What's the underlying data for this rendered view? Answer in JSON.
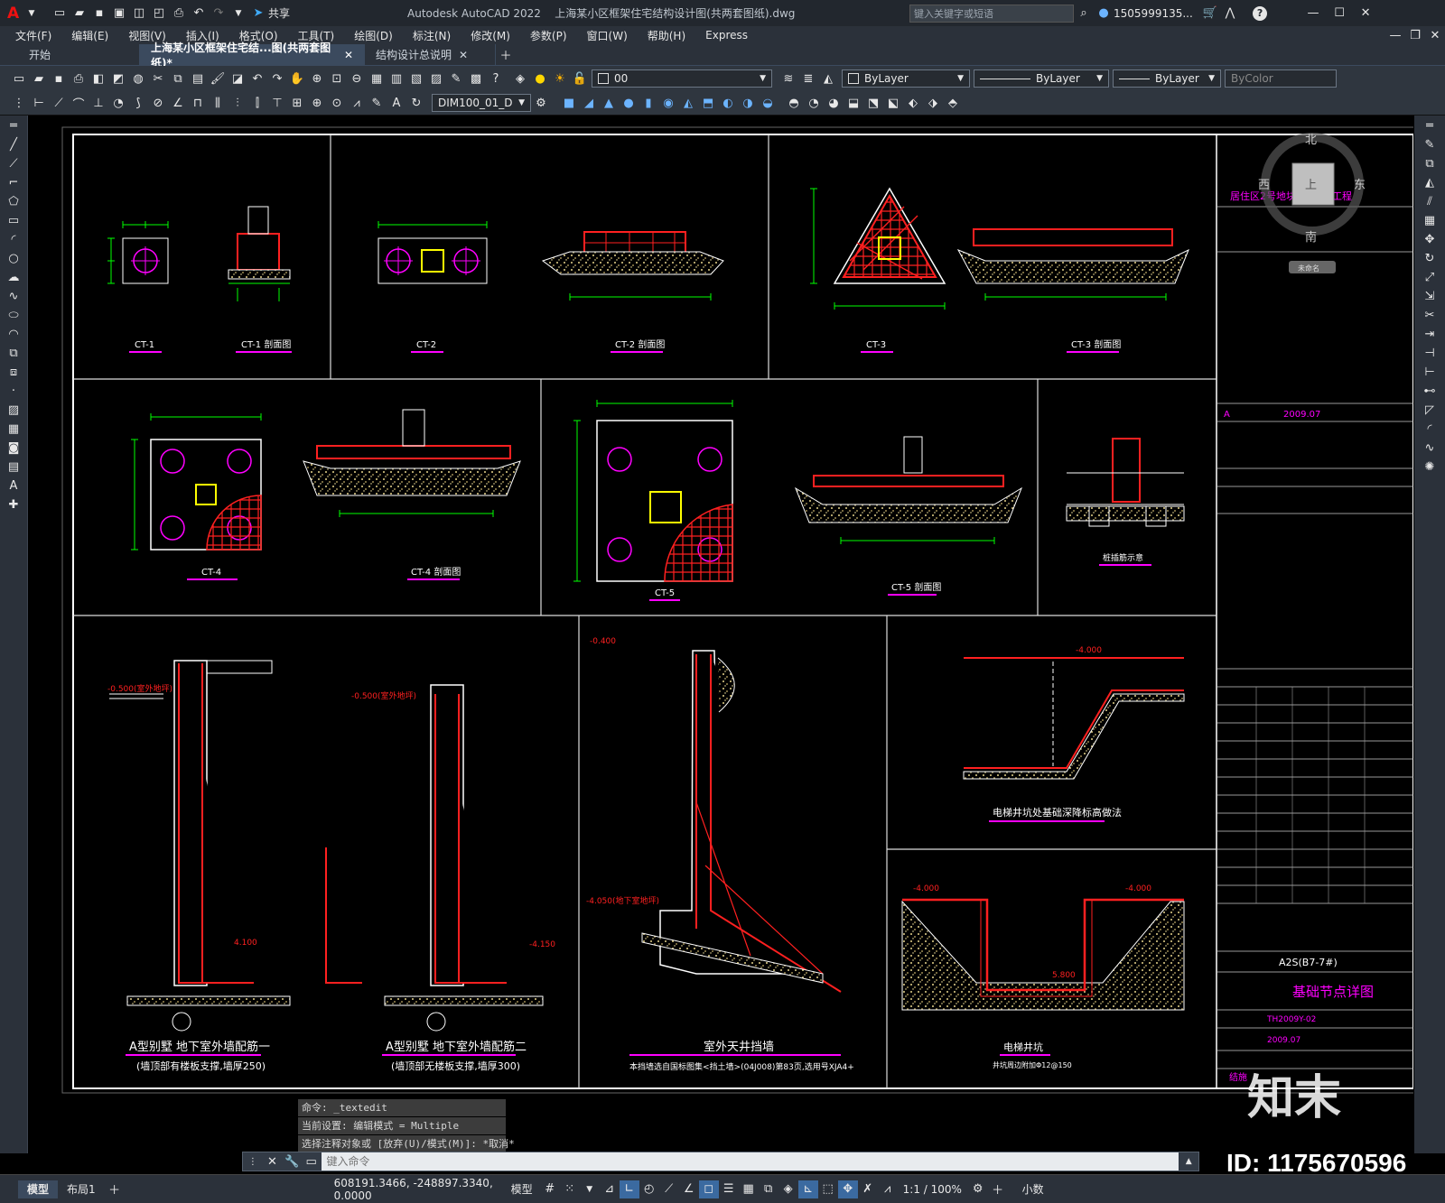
{
  "titlebar": {
    "app_letter": "A",
    "share_label": "共享",
    "title": "Autodesk AutoCAD 2022    上海某小区框架住宅结构设计图(共两套图纸).dwg",
    "search_placeholder": "键入关键字或短语",
    "user": "1505999135...",
    "help": "?"
  },
  "menu": [
    "文件(F)",
    "编辑(E)",
    "视图(V)",
    "插入(I)",
    "格式(O)",
    "工具(T)",
    "绘图(D)",
    "标注(N)",
    "修改(M)",
    "参数(P)",
    "窗口(W)",
    "帮助(H)",
    "Express"
  ],
  "tabs": [
    {
      "label": "开始"
    },
    {
      "label": "上海某小区框架住宅结...图(共两套图纸)*"
    },
    {
      "label": "结构设计总说明"
    }
  ],
  "toolbar": {
    "layer_value": "00",
    "color_value": "ByLayer",
    "linetype_value": "ByLayer",
    "lineweight_value": "ByLayer",
    "plotstyle_value": "ByColor",
    "dimstyle_value": "DIM100_01_D"
  },
  "viewcube": {
    "north": "北",
    "south": "南",
    "west": "西",
    "east": "东",
    "top": "上",
    "wcs": "未命名"
  },
  "drawing": {
    "ct1": "CT-1",
    "ct1s": "CT-1 剖面图",
    "ct2": "CT-2",
    "ct2s": "CT-2 剖面图",
    "ct3": "CT-3",
    "ct3s": "CT-3 剖面图",
    "ct4": "CT-4",
    "ct4s": "CT-4 剖面图",
    "ct5": "CT-5",
    "ct5s": "CT-5 剖面图",
    "pile": "桩插筋示意",
    "wall1": "A型别墅  地下室外墙配筋一",
    "wall1_note": "(墙顶部有楼板支撑,墙厚250)",
    "wall2": "A型别墅  地下室外墙配筋二",
    "wall2_note": "(墙顶部无楼板支撑,墙厚300)",
    "patio": "室外天井挡墙",
    "patio_note": "本挡墙选自国标图集<挡土墙>(04J008)第83页,选用号XJA4+",
    "elev": "电梯井坑处基础深降标高做法",
    "pit": "电梯井坑",
    "pit_note": "井坑周边附加Φ12@150",
    "lvl_m0400": "-0.400",
    "lvl_m0500": "-0.500(室外地坪)",
    "lvl_m4000": "-4.000",
    "lvl_m4050": "-4.050(地下室地坪)",
    "lvl_5800": "5.800",
    "lvl_4100": "4.100",
    "lvl_4150": "-4.150",
    "project": "居住区2号地块2层住宅工程",
    "rev": "A",
    "date": "2009.07",
    "sheet_code": "A2S(B7-7#)",
    "sheet_title": "基础节点详图",
    "sheet_no": "TH2009Y-02",
    "sheet_date": "2009.07",
    "sheet_label": "结施"
  },
  "watermark": {
    "brand": "知末",
    "id": "ID: 1175670596"
  },
  "command": {
    "history": [
      "命令: _textedit",
      "当前设置: 编辑模式 = Multiple",
      "选择注释对象或 [放弃(U)/模式(M)]: *取消*"
    ],
    "placeholder": "键入命令"
  },
  "status": {
    "tabs": [
      "模型",
      "布局1"
    ],
    "coords": "608191.3466, -248897.3340, 0.0000",
    "space": "模型",
    "scale": "1:1 / 100%",
    "units": "小数"
  },
  "colors": {
    "accent": "#ff0000",
    "dim": "#00ff00",
    "mark": "#ff00ff",
    "hot": "#ffff00",
    "text": "#ffffff"
  }
}
